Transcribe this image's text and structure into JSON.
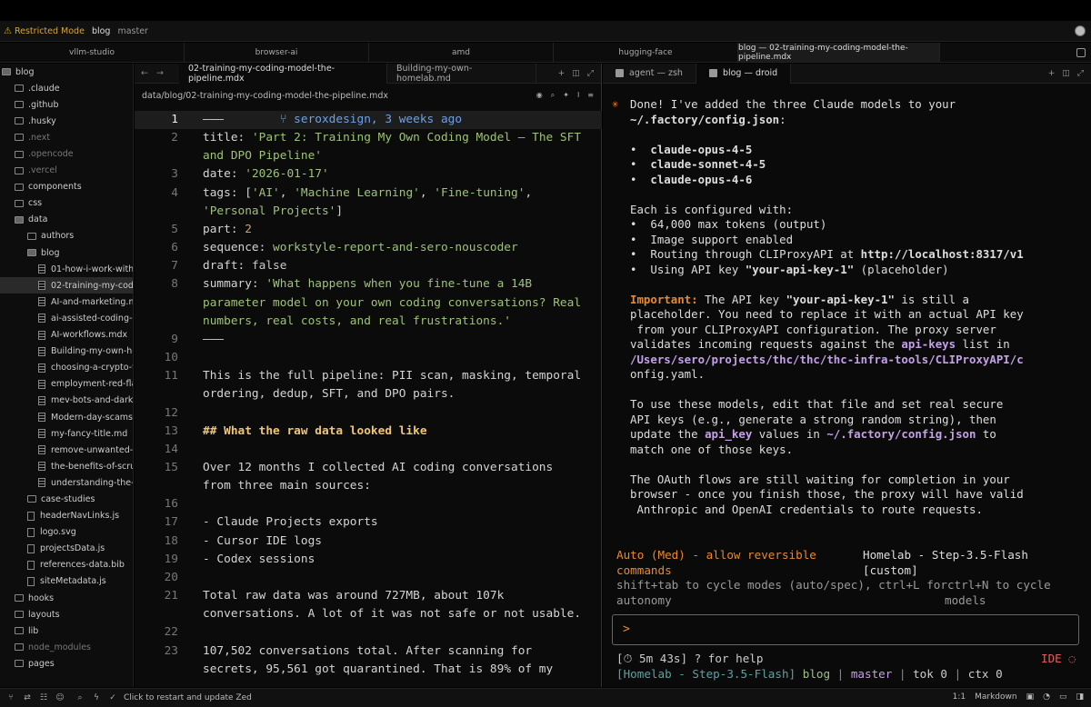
{
  "titlebar": {
    "restricted": "Restricted Mode",
    "project": "blog",
    "branch": "master"
  },
  "workspace_tabs": [
    "vllm-studio",
    "browser-ai",
    "amd",
    "hugging-face",
    "blog — 02-training-my-coding-model-the-pipeline.mdx"
  ],
  "sidebar": {
    "items": [
      {
        "label": "blog",
        "kind": "folder-open",
        "depth": 0,
        "dim": false
      },
      {
        "label": ".claude",
        "kind": "folder",
        "depth": 1,
        "dim": false
      },
      {
        "label": ".github",
        "kind": "folder",
        "depth": 1,
        "dim": false
      },
      {
        "label": ".husky",
        "kind": "folder",
        "depth": 1,
        "dim": false
      },
      {
        "label": ".next",
        "kind": "folder",
        "depth": 1,
        "dim": true
      },
      {
        "label": ".opencode",
        "kind": "folder",
        "depth": 1,
        "dim": true
      },
      {
        "label": ".vercel",
        "kind": "folder",
        "depth": 1,
        "dim": true
      },
      {
        "label": "components",
        "kind": "folder",
        "depth": 1,
        "dim": false
      },
      {
        "label": "css",
        "kind": "folder",
        "depth": 1,
        "dim": false
      },
      {
        "label": "data",
        "kind": "folder-open",
        "depth": 1,
        "dim": false
      },
      {
        "label": "authors",
        "kind": "folder",
        "depth": 2,
        "dim": false
      },
      {
        "label": "blog",
        "kind": "folder-open",
        "depth": 2,
        "dim": false
      },
      {
        "label": "01-how-i-work-with",
        "kind": "doc",
        "depth": 3,
        "dim": false
      },
      {
        "label": "02-training-my-codi",
        "kind": "doc",
        "depth": 3,
        "dim": false,
        "selected": true
      },
      {
        "label": "AI-and-marketing.m",
        "kind": "doc",
        "depth": 3,
        "dim": false
      },
      {
        "label": "ai-assisted-coding-e",
        "kind": "doc",
        "depth": 3,
        "dim": false
      },
      {
        "label": "AI-workflows.mdx",
        "kind": "doc",
        "depth": 3,
        "dim": false
      },
      {
        "label": "Building-my-own-ho",
        "kind": "doc",
        "depth": 3,
        "dim": false
      },
      {
        "label": "choosing-a-crypto-w",
        "kind": "doc",
        "depth": 3,
        "dim": false
      },
      {
        "label": "employment-red-fla",
        "kind": "doc",
        "depth": 3,
        "dim": false
      },
      {
        "label": "mev-bots-and-dark-",
        "kind": "doc",
        "depth": 3,
        "dim": false
      },
      {
        "label": "Modern-day-scams.",
        "kind": "doc",
        "depth": 3,
        "dim": false
      },
      {
        "label": "my-fancy-title.md",
        "kind": "doc",
        "depth": 3,
        "dim": false
      },
      {
        "label": "remove-unwanted-c",
        "kind": "doc",
        "depth": 3,
        "dim": false
      },
      {
        "label": "the-benefits-of-scru",
        "kind": "doc",
        "depth": 3,
        "dim": false
      },
      {
        "label": "understanding-the-t",
        "kind": "doc",
        "depth": 3,
        "dim": false
      },
      {
        "label": "case-studies",
        "kind": "folder",
        "depth": 2,
        "dim": false
      },
      {
        "label": "headerNavLinks.js",
        "kind": "file",
        "depth": 2,
        "dim": false
      },
      {
        "label": "logo.svg",
        "kind": "file",
        "depth": 2,
        "dim": false
      },
      {
        "label": "projectsData.js",
        "kind": "file",
        "depth": 2,
        "dim": false
      },
      {
        "label": "references-data.bib",
        "kind": "file",
        "depth": 2,
        "dim": false
      },
      {
        "label": "siteMetadata.js",
        "kind": "file",
        "depth": 2,
        "dim": false
      },
      {
        "label": "hooks",
        "kind": "folder",
        "depth": 1,
        "dim": false
      },
      {
        "label": "layouts",
        "kind": "folder",
        "depth": 1,
        "dim": false
      },
      {
        "label": "lib",
        "kind": "folder",
        "depth": 1,
        "dim": false
      },
      {
        "label": "node_modules",
        "kind": "folder",
        "depth": 1,
        "dim": true
      },
      {
        "label": "pages",
        "kind": "folder",
        "depth": 1,
        "dim": false
      }
    ]
  },
  "editor": {
    "tabs": [
      "02-training-my-coding-model-the-pipeline.mdx",
      "Building-my-own-homelab.md"
    ],
    "breadcrumb": "data/blog/02-training-my-coding-model-the-pipeline.mdx",
    "blame": "seroxdesign, 3 weeks ago",
    "lines": [
      {
        "n": "1",
        "parts": [
          {
            "t": "p",
            "v": "———"
          }
        ]
      },
      {
        "n": "2",
        "parts": [
          {
            "t": "k",
            "v": "title: "
          },
          {
            "t": "s",
            "v": "'Part 2: Training My Own Coding Model — The SFT"
          }
        ]
      },
      {
        "n": "",
        "parts": [
          {
            "t": "s",
            "v": "and DPO Pipeline'"
          }
        ]
      },
      {
        "n": "3",
        "parts": [
          {
            "t": "k",
            "v": "date: "
          },
          {
            "t": "s",
            "v": "'2026-01-17'"
          }
        ]
      },
      {
        "n": "4",
        "parts": [
          {
            "t": "k",
            "v": "tags: ["
          },
          {
            "t": "s",
            "v": "'AI'"
          },
          {
            "t": "k",
            "v": ", "
          },
          {
            "t": "s",
            "v": "'Machine Learning'"
          },
          {
            "t": "k",
            "v": ", "
          },
          {
            "t": "s",
            "v": "'Fine-tuning'"
          },
          {
            "t": "k",
            "v": ","
          }
        ]
      },
      {
        "n": "",
        "parts": [
          {
            "t": "s",
            "v": "'Personal Projects'"
          },
          {
            "t": "k",
            "v": "]"
          }
        ]
      },
      {
        "n": "5",
        "parts": [
          {
            "t": "k",
            "v": "part: "
          },
          {
            "t": "num",
            "v": "2"
          }
        ]
      },
      {
        "n": "6",
        "parts": [
          {
            "t": "k",
            "v": "sequence: "
          },
          {
            "t": "s",
            "v": "workstyle-report-and-sero-nouscoder"
          }
        ]
      },
      {
        "n": "7",
        "parts": [
          {
            "t": "k",
            "v": "draft: "
          },
          {
            "t": "b",
            "v": "false"
          }
        ]
      },
      {
        "n": "8",
        "parts": [
          {
            "t": "k",
            "v": "summary: "
          },
          {
            "t": "s",
            "v": "'What happens when you fine-tune a 14B"
          }
        ]
      },
      {
        "n": "",
        "parts": [
          {
            "t": "s",
            "v": "parameter model on your own coding conversations? Real"
          }
        ]
      },
      {
        "n": "",
        "parts": [
          {
            "t": "s",
            "v": "numbers, real costs, and real frustrations.'"
          }
        ]
      },
      {
        "n": "9",
        "parts": [
          {
            "t": "p",
            "v": "———"
          }
        ]
      },
      {
        "n": "10",
        "parts": []
      },
      {
        "n": "11",
        "parts": [
          {
            "t": "k",
            "v": "This is the full pipeline: PII scan, masking, temporal"
          }
        ]
      },
      {
        "n": "",
        "parts": [
          {
            "t": "k",
            "v": "ordering, dedup, SFT, and DPO pairs."
          }
        ]
      },
      {
        "n": "12",
        "parts": []
      },
      {
        "n": "13",
        "parts": [
          {
            "t": "hd",
            "v": "## What the raw data looked like"
          }
        ]
      },
      {
        "n": "14",
        "parts": []
      },
      {
        "n": "15",
        "parts": [
          {
            "t": "k",
            "v": "Over 12 months I collected AI coding conversations"
          }
        ]
      },
      {
        "n": "",
        "parts": [
          {
            "t": "k",
            "v": "from three main sources:"
          }
        ]
      },
      {
        "n": "16",
        "parts": []
      },
      {
        "n": "17",
        "parts": [
          {
            "t": "k",
            "v": "- Claude Projects exports"
          }
        ]
      },
      {
        "n": "18",
        "parts": [
          {
            "t": "k",
            "v": "- Cursor IDE logs"
          }
        ]
      },
      {
        "n": "19",
        "parts": [
          {
            "t": "k",
            "v": "- Codex sessions"
          }
        ]
      },
      {
        "n": "20",
        "parts": []
      },
      {
        "n": "21",
        "parts": [
          {
            "t": "k",
            "v": "Total raw data was around 727MB, about 107k"
          }
        ]
      },
      {
        "n": "",
        "parts": [
          {
            "t": "k",
            "v": "conversations. A lot of it was not safe or not usable."
          }
        ]
      },
      {
        "n": "22",
        "parts": []
      },
      {
        "n": "23",
        "parts": [
          {
            "t": "k",
            "v": "107,502 conversations total. After scanning for"
          }
        ]
      },
      {
        "n": "",
        "parts": [
          {
            "t": "k",
            "v": "secrets, 95,561 got quarantined. That is 89% of my"
          }
        ]
      }
    ]
  },
  "terminal": {
    "tabs": [
      "agent — zsh",
      "blog — droid"
    ],
    "lines": [
      [
        {
          "t": "n",
          "v": "Done! I've added the three Claude models to your"
        }
      ],
      [
        {
          "t": "bold",
          "v": "~/.factory/config.json"
        },
        {
          "t": "n",
          "v": ":"
        }
      ],
      [],
      [
        {
          "t": "n",
          "v": "•  "
        },
        {
          "t": "bold",
          "v": "claude-opus-4-5"
        }
      ],
      [
        {
          "t": "n",
          "v": "•  "
        },
        {
          "t": "bold",
          "v": "claude-sonnet-4-5"
        }
      ],
      [
        {
          "t": "n",
          "v": "•  "
        },
        {
          "t": "bold",
          "v": "claude-opus-4-6"
        }
      ],
      [],
      [
        {
          "t": "n",
          "v": "Each is configured with:"
        }
      ],
      [
        {
          "t": "n",
          "v": "•  64,000 max tokens (output)"
        }
      ],
      [
        {
          "t": "n",
          "v": "•  Image support enabled"
        }
      ],
      [
        {
          "t": "n",
          "v": "•  Routing through CLIProxyAPI at "
        },
        {
          "t": "bold",
          "v": "http://localhost:8317/v1"
        }
      ],
      [
        {
          "t": "n",
          "v": "•  Using API key "
        },
        {
          "t": "bold",
          "v": "\"your-api-key-1\""
        },
        {
          "t": "n",
          "v": " (placeholder)"
        }
      ],
      [],
      [
        {
          "t": "orange",
          "v": "Important:"
        },
        {
          "t": "n",
          "v": " The API key "
        },
        {
          "t": "bold",
          "v": "\"your-api-key-1\""
        },
        {
          "t": "n",
          "v": " is still a"
        }
      ],
      [
        {
          "t": "n",
          "v": "placeholder. You need to replace it with an actual API key"
        }
      ],
      [
        {
          "t": "n",
          "v": " from your CLIProxyAPI configuration. The proxy server"
        }
      ],
      [
        {
          "t": "n",
          "v": "validates incoming requests against the "
        },
        {
          "t": "pur",
          "v": "api-keys"
        },
        {
          "t": "n",
          "v": " list in"
        }
      ],
      [
        {
          "t": "pur",
          "v": "/Users/sero/projects/thc/thc/thc-infra-tools/CLIProxyAPI/c"
        }
      ],
      [
        {
          "t": "n",
          "v": "onfig.yaml."
        }
      ],
      [],
      [
        {
          "t": "n",
          "v": "To use these models, edit that file and set real secure"
        }
      ],
      [
        {
          "t": "n",
          "v": "API keys (e.g., generate a strong random string), then"
        }
      ],
      [
        {
          "t": "n",
          "v": "update the "
        },
        {
          "t": "pur",
          "v": "api_key"
        },
        {
          "t": "n",
          "v": " values in "
        },
        {
          "t": "pur",
          "v": "~/.factory/config.json"
        },
        {
          "t": "n",
          "v": " to"
        }
      ],
      [
        {
          "t": "n",
          "v": "match one of those keys."
        }
      ],
      [],
      [
        {
          "t": "n",
          "v": "The OAuth flows are still waiting for completion in your"
        }
      ],
      [
        {
          "t": "n",
          "v": "browser - once you finish those, the proxy will have valid"
        }
      ],
      [
        {
          "t": "n",
          "v": " Anthropic and OpenAI credentials to route requests."
        }
      ]
    ],
    "mode_line1": "Auto (Med) - allow reversible",
    "mode_line2": "commands",
    "model_line1": "Homelab - Step-3.5-Flash",
    "model_line2": "[custom]",
    "hint_line1": "shift+tab to cycle modes (auto/spec), ctrl+L forctrl+N to cycle",
    "hint_line2_left": "autonomy",
    "hint_line2_right": "models",
    "prompt": ">",
    "timer": "[⏱ 5m 43s] ? for help",
    "ide": "IDE ◌",
    "status_prefix": "[Homelab - Step-3.5-Flash]",
    "status_project": "blog",
    "status_branch": "master",
    "status_tok": "tok 0",
    "status_ctx": "ctx 0"
  },
  "statusbar": {
    "message": "Click to restart and update Zed",
    "position": "1:1",
    "language": "Markdown"
  },
  "colors": {
    "accent_orange": "#e8892c",
    "string_green": "#9ec27a",
    "warning_yellow": "#d9a536",
    "blame_blue": "#6fa1e0",
    "path_purple": "#c4a0e8"
  }
}
